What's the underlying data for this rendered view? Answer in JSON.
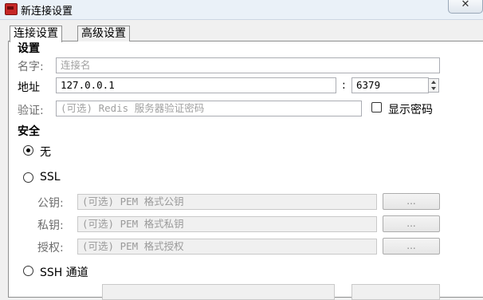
{
  "window": {
    "title": "新连接设置",
    "close_label": "✕"
  },
  "tabs": [
    {
      "label": "连接设置"
    },
    {
      "label": "高级设置"
    }
  ],
  "settings": {
    "heading": "设置",
    "name_label": "名字:",
    "name_placeholder": "连接名",
    "address_label": "地址",
    "address_value": "127.0.0.1",
    "port_separator": ":",
    "port_value": "6379",
    "auth_label": "验证:",
    "auth_placeholder": "(可选) Redis 服务器验证密码",
    "show_password_label": "显示密码"
  },
  "security": {
    "heading": "安全",
    "option_none": "无",
    "option_ssl": "SSL",
    "public_key_label": "公钥:",
    "public_key_placeholder": "(可选) PEM 格式公钥",
    "private_key_label": "私钥:",
    "private_key_placeholder": "(可选) PEM 格式私钥",
    "authority_label": "授权:",
    "authority_placeholder": "(可选) PEM 格式授权",
    "browse_label": "...",
    "option_ssh": "SSH 通道",
    "selected": "无"
  }
}
